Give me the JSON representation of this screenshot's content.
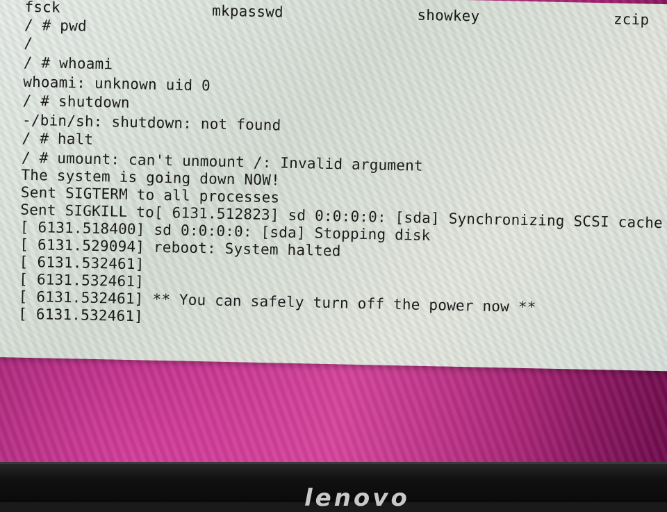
{
  "terminal": {
    "lines": [
      "fsck                 mkpasswd               showkey               zcip",
      "/ # pwd",
      "/",
      "/ # whoami",
      "whoami: unknown uid 0",
      "/ # shutdown",
      "-/bin/sh: shutdown: not found",
      "/ # halt",
      "/ # umount: can't unmount /: Invalid argument",
      "The system is going down NOW!",
      "Sent SIGTERM to all processes",
      "Sent SIGKILL to[ 6131.512823] sd 0:0:0:0: [sda] Synchronizing SCSI cache",
      "[ 6131.518400] sd 0:0:0:0: [sda] Stopping disk",
      "[ 6131.529094] reboot: System halted",
      "[ 6131.532461]",
      "[ 6131.532461]",
      "[ 6131.532461] ** You can safely turn off the power now **",
      "[ 6131.532461]"
    ]
  },
  "monitor": {
    "brand": "lenovo"
  },
  "colors": {
    "terminal_bg": "#e6e6e2",
    "text": "#161616",
    "desktop": "#a01f6e",
    "bezel": "#111111"
  }
}
